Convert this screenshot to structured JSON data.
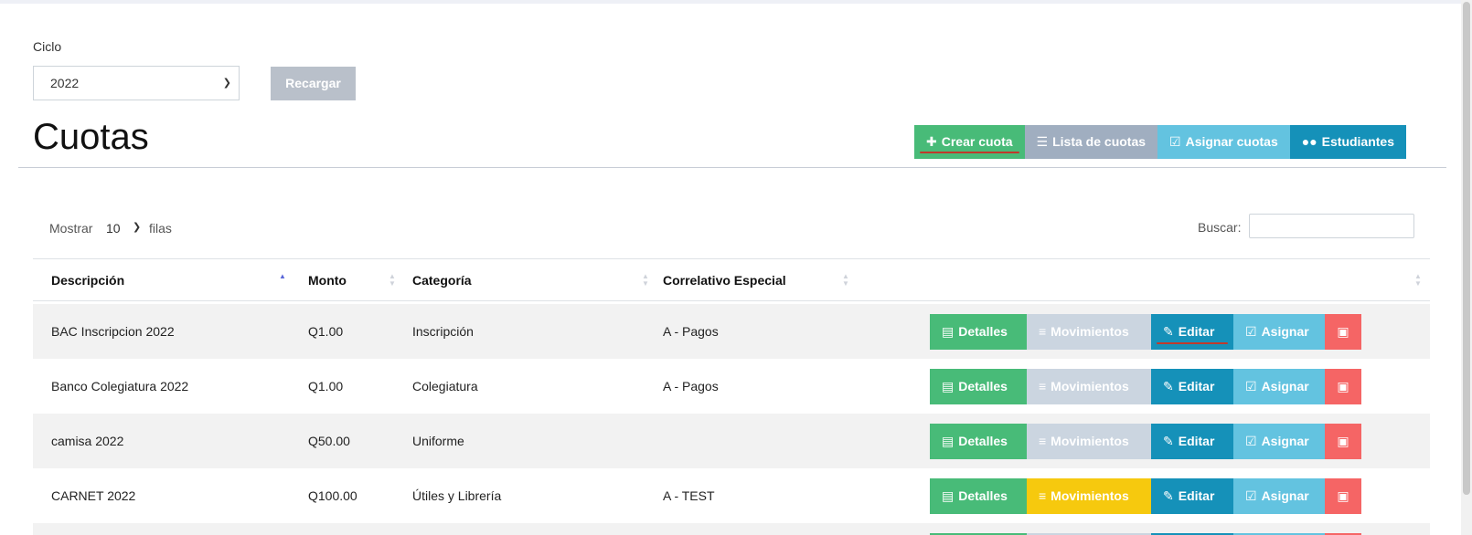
{
  "filter": {
    "ciclo_label": "Ciclo",
    "ciclo_value": "2022",
    "reload_label": "Recargar"
  },
  "header": {
    "title": "Cuotas",
    "buttons": [
      {
        "label": "Crear cuota",
        "icon": "plus-icon"
      },
      {
        "label": "Lista de cuotas",
        "icon": "list-icon"
      },
      {
        "label": "Asignar cuotas",
        "icon": "check-square-icon"
      },
      {
        "label": "Estudiantes",
        "icon": "users-icon"
      }
    ]
  },
  "table_controls": {
    "show_label": "Mostrar",
    "page_length": "10",
    "rows_label": "filas",
    "search_label": "Buscar:",
    "search_value": ""
  },
  "table": {
    "columns": [
      "Descripción",
      "Monto",
      "Categoría",
      "Correlativo Especial"
    ],
    "rows": [
      {
        "descripcion": "BAC Inscripcion 2022",
        "monto": "Q1.00",
        "categoria": "Inscripción",
        "correlativo": "A - Pagos"
      },
      {
        "descripcion": "Banco Colegiatura 2022",
        "monto": "Q1.00",
        "categoria": "Colegiatura",
        "correlativo": "A - Pagos"
      },
      {
        "descripcion": "camisa 2022",
        "monto": "Q50.00",
        "categoria": "Uniforme",
        "correlativo": ""
      },
      {
        "descripcion": "CARNET 2022",
        "monto": "Q100.00",
        "categoria": "Útiles y Librería",
        "correlativo": "A - TEST"
      }
    ],
    "actions": {
      "details": "Detalles",
      "movements": "Movimientos",
      "edit": "Editar",
      "assign": "Asignar"
    }
  },
  "colors": {
    "green": "#48bb78",
    "gray": "#a0aec0",
    "light_blue": "#63c3e0",
    "blue": "#1591b9",
    "yellow": "#f6c90e",
    "red": "#f56565"
  }
}
